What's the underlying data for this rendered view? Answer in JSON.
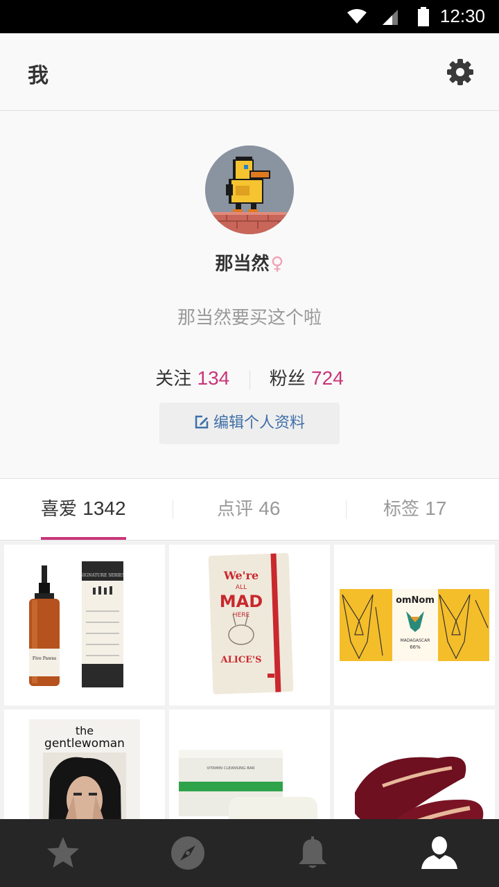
{
  "status_bar": {
    "time": "12:30"
  },
  "header": {
    "title": "我"
  },
  "profile": {
    "nickname": "那当然",
    "gender_symbol": "♀",
    "bio": "那当然要买这个啦",
    "following_label": "关注",
    "following_count": "134",
    "followers_label": "粉丝",
    "followers_count": "724",
    "edit_button": "编辑个人资料"
  },
  "tabs": [
    {
      "label": "喜爱",
      "count": "1342",
      "active": true
    },
    {
      "label": "点评",
      "count": "46",
      "active": false
    },
    {
      "label": "标签",
      "count": "17",
      "active": false
    }
  ],
  "grid_items": [
    {
      "name": "Five Pawns e-liquid bottle & tube",
      "text": [
        "Five Pawns",
        "SIGNATURE SERIES"
      ]
    },
    {
      "name": "Moleskine Alice notebook",
      "text": [
        "We're",
        "ALL",
        "MAD",
        "HERE",
        "ALICE'S"
      ]
    },
    {
      "name": "Omnom Madagascar chocolate",
      "text": [
        "omNom",
        "MADAGASCAR",
        "66%"
      ]
    },
    {
      "name": "The Gentlewoman magazine",
      "text": [
        "the",
        "gentlewoman"
      ]
    },
    {
      "name": "Vitamin cleansing bar soap",
      "text": [
        "VITAMIN CLEANSING BAR"
      ]
    },
    {
      "name": "Burgundy velvet tassel loafers",
      "text": []
    }
  ],
  "nav": [
    {
      "icon": "star-icon",
      "active": false
    },
    {
      "icon": "compass-icon",
      "active": false
    },
    {
      "icon": "bell-icon",
      "active": false
    },
    {
      "icon": "person-icon",
      "active": true
    }
  ],
  "colors": {
    "accent": "#c8357a",
    "link": "#3f6fa8",
    "navbar": "#262626"
  }
}
